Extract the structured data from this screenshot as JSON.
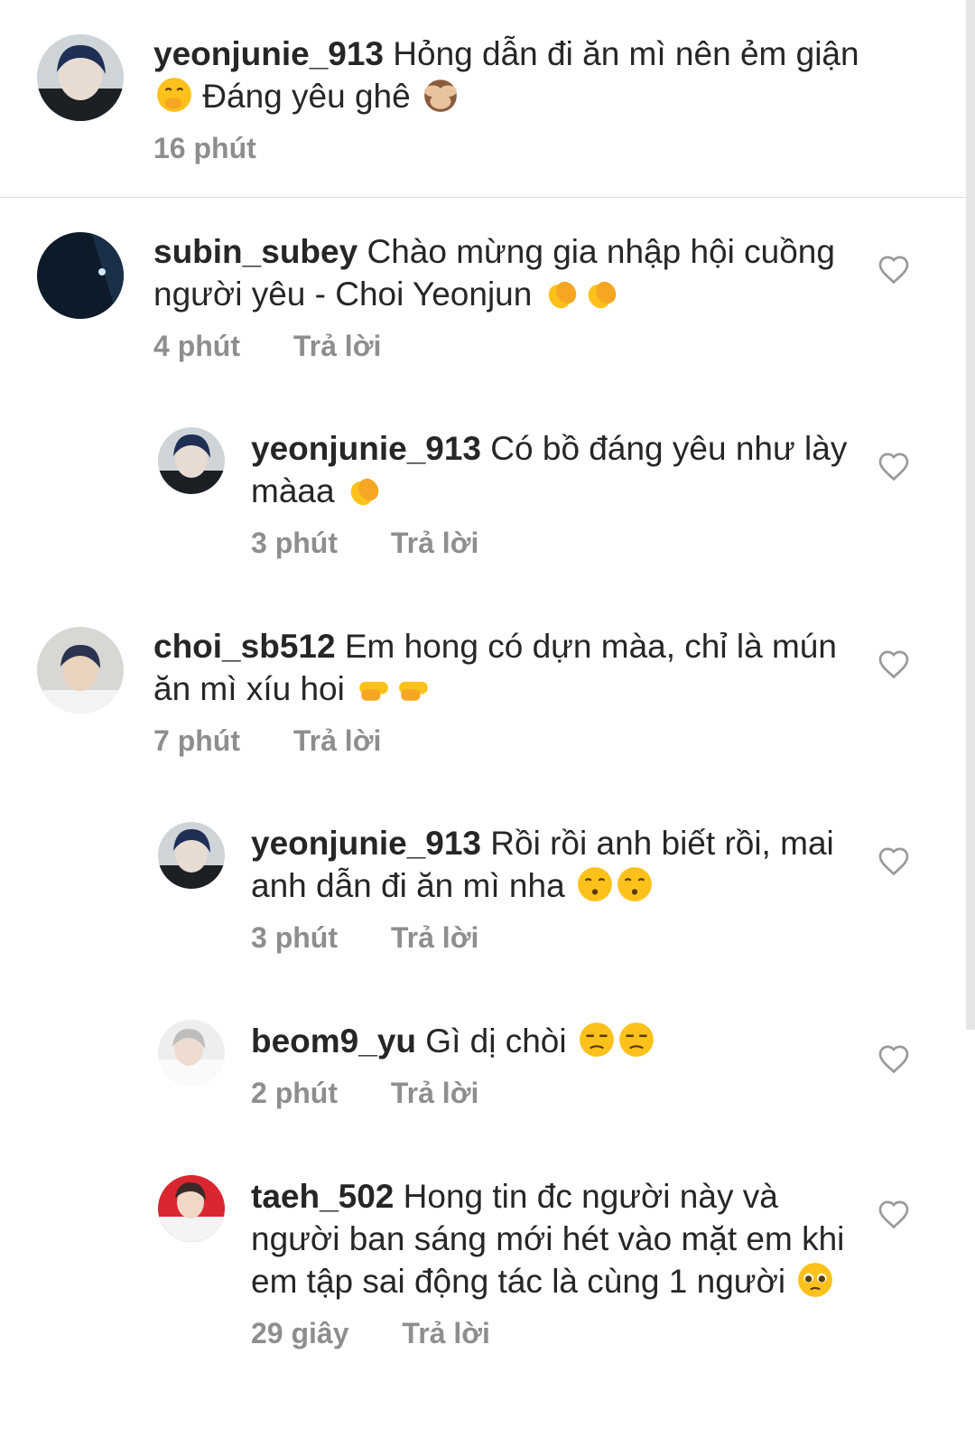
{
  "caption": {
    "username": "yeonjunie_913",
    "text": "Hỏng dẫn đi ăn mì nên ẻm giận",
    "text2": "Đáng yêu ghê",
    "time": "16 phút"
  },
  "comments": [
    {
      "username": "subin_subey",
      "text": "Chào mừng gia nhập hội cuồng người yêu - Choi Yeonjun",
      "time": "4 phút",
      "reply": "Trả lời"
    },
    {
      "username": "yeonjunie_913",
      "text": "Có bồ đáng yêu như lày màaa",
      "time": "3 phút",
      "reply": "Trả lời"
    },
    {
      "username": "choi_sb512",
      "text": "Em hong có dựn màa, chỉ là mún ăn mì xíu hoi",
      "time": "7 phút",
      "reply": "Trả lời"
    },
    {
      "username": "yeonjunie_913",
      "text": "Rồi rồi anh biết rồi, mai anh dẫn đi ăn mì nha",
      "time": "3 phút",
      "reply": "Trả lời"
    },
    {
      "username": "beom9_yu",
      "text": "Gì dị chòi",
      "time": "2 phút",
      "reply": "Trả lời"
    },
    {
      "username": "taeh_502",
      "text": "Hong tin đc người này và người ban sáng mới hét vào mặt em khi em tập sai động tác là cùng 1 người",
      "time": "29 giây",
      "reply": "Trả lời"
    }
  ],
  "icons": {
    "heart": "heart-outline-icon",
    "emojis": [
      "hand-over-mouth",
      "see-no-evil-monkey",
      "clapping-hands",
      "backhand-index-pointing-right",
      "kissing-face",
      "unamused-face",
      "pleading-face"
    ]
  }
}
